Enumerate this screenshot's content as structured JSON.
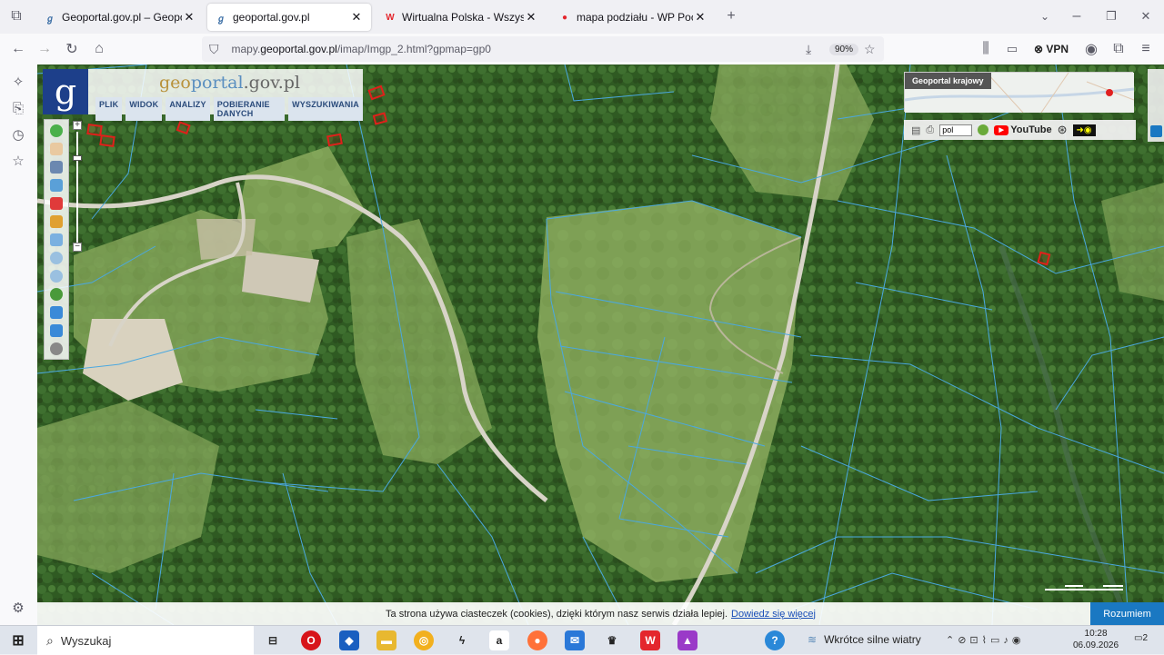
{
  "browser": {
    "tabs": [
      {
        "title": "Geoportal.gov.pl – Geoportal In",
        "active": false
      },
      {
        "title": "geoportal.gov.pl",
        "active": true
      },
      {
        "title": "Wirtualna Polska - Wszystko co",
        "active": false
      },
      {
        "title": "mapa podziału - WP Poczta",
        "active": false
      }
    ],
    "url_prefix": "mapy.",
    "url_domain": "geoportal.gov.pl",
    "url_path": "/imap/Imgp_2.html?gpmap=gp0",
    "zoom": "90%",
    "vpn_label": "VPN"
  },
  "geoportal": {
    "brand_part1": "geo",
    "brand_part2": "portal",
    "brand_part3": ".gov.pl",
    "menu": [
      "PLIK",
      "WIDOK",
      "ANALIZY",
      "POBIERANIE DANYCH",
      "WYSZUKIWANIA"
    ],
    "overview_label": "Geoportal krajowy",
    "language": "pol",
    "youtube": "YouTube"
  },
  "cookie": {
    "text": "Ta strona używa ciasteczek (cookies), dzięki którym nasz serwis działa lepiej.",
    "link": "Dowiedz się więcej",
    "button": "Rozumiem"
  },
  "taskbar": {
    "search_placeholder": "Wyszukaj",
    "weather": "Wkrótce silne wiatry",
    "time": "10:28",
    "date": "06.09.2026",
    "notifications": "2"
  },
  "colors": {
    "parcel_lines": "#4aa8e0",
    "building_outline": "#e0201a",
    "road": "#d8d4c8",
    "accent": "#1a78c2"
  }
}
